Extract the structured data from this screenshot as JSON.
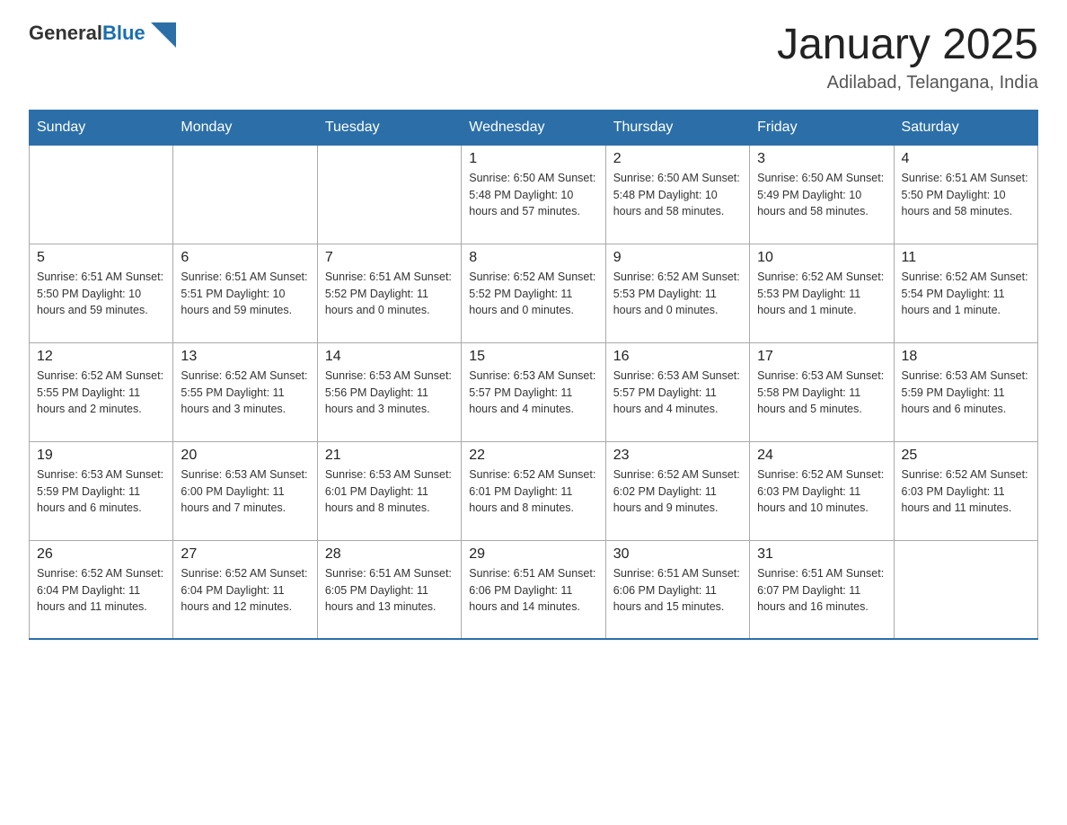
{
  "header": {
    "logo_text_general": "General",
    "logo_text_blue": "Blue",
    "title": "January 2025",
    "subtitle": "Adilabad, Telangana, India"
  },
  "weekdays": [
    "Sunday",
    "Monday",
    "Tuesday",
    "Wednesday",
    "Thursday",
    "Friday",
    "Saturday"
  ],
  "weeks": [
    [
      {
        "day": "",
        "info": ""
      },
      {
        "day": "",
        "info": ""
      },
      {
        "day": "",
        "info": ""
      },
      {
        "day": "1",
        "info": "Sunrise: 6:50 AM\nSunset: 5:48 PM\nDaylight: 10 hours\nand 57 minutes."
      },
      {
        "day": "2",
        "info": "Sunrise: 6:50 AM\nSunset: 5:48 PM\nDaylight: 10 hours\nand 58 minutes."
      },
      {
        "day": "3",
        "info": "Sunrise: 6:50 AM\nSunset: 5:49 PM\nDaylight: 10 hours\nand 58 minutes."
      },
      {
        "day": "4",
        "info": "Sunrise: 6:51 AM\nSunset: 5:50 PM\nDaylight: 10 hours\nand 58 minutes."
      }
    ],
    [
      {
        "day": "5",
        "info": "Sunrise: 6:51 AM\nSunset: 5:50 PM\nDaylight: 10 hours\nand 59 minutes."
      },
      {
        "day": "6",
        "info": "Sunrise: 6:51 AM\nSunset: 5:51 PM\nDaylight: 10 hours\nand 59 minutes."
      },
      {
        "day": "7",
        "info": "Sunrise: 6:51 AM\nSunset: 5:52 PM\nDaylight: 11 hours\nand 0 minutes."
      },
      {
        "day": "8",
        "info": "Sunrise: 6:52 AM\nSunset: 5:52 PM\nDaylight: 11 hours\nand 0 minutes."
      },
      {
        "day": "9",
        "info": "Sunrise: 6:52 AM\nSunset: 5:53 PM\nDaylight: 11 hours\nand 0 minutes."
      },
      {
        "day": "10",
        "info": "Sunrise: 6:52 AM\nSunset: 5:53 PM\nDaylight: 11 hours\nand 1 minute."
      },
      {
        "day": "11",
        "info": "Sunrise: 6:52 AM\nSunset: 5:54 PM\nDaylight: 11 hours\nand 1 minute."
      }
    ],
    [
      {
        "day": "12",
        "info": "Sunrise: 6:52 AM\nSunset: 5:55 PM\nDaylight: 11 hours\nand 2 minutes."
      },
      {
        "day": "13",
        "info": "Sunrise: 6:52 AM\nSunset: 5:55 PM\nDaylight: 11 hours\nand 3 minutes."
      },
      {
        "day": "14",
        "info": "Sunrise: 6:53 AM\nSunset: 5:56 PM\nDaylight: 11 hours\nand 3 minutes."
      },
      {
        "day": "15",
        "info": "Sunrise: 6:53 AM\nSunset: 5:57 PM\nDaylight: 11 hours\nand 4 minutes."
      },
      {
        "day": "16",
        "info": "Sunrise: 6:53 AM\nSunset: 5:57 PM\nDaylight: 11 hours\nand 4 minutes."
      },
      {
        "day": "17",
        "info": "Sunrise: 6:53 AM\nSunset: 5:58 PM\nDaylight: 11 hours\nand 5 minutes."
      },
      {
        "day": "18",
        "info": "Sunrise: 6:53 AM\nSunset: 5:59 PM\nDaylight: 11 hours\nand 6 minutes."
      }
    ],
    [
      {
        "day": "19",
        "info": "Sunrise: 6:53 AM\nSunset: 5:59 PM\nDaylight: 11 hours\nand 6 minutes."
      },
      {
        "day": "20",
        "info": "Sunrise: 6:53 AM\nSunset: 6:00 PM\nDaylight: 11 hours\nand 7 minutes."
      },
      {
        "day": "21",
        "info": "Sunrise: 6:53 AM\nSunset: 6:01 PM\nDaylight: 11 hours\nand 8 minutes."
      },
      {
        "day": "22",
        "info": "Sunrise: 6:52 AM\nSunset: 6:01 PM\nDaylight: 11 hours\nand 8 minutes."
      },
      {
        "day": "23",
        "info": "Sunrise: 6:52 AM\nSunset: 6:02 PM\nDaylight: 11 hours\nand 9 minutes."
      },
      {
        "day": "24",
        "info": "Sunrise: 6:52 AM\nSunset: 6:03 PM\nDaylight: 11 hours\nand 10 minutes."
      },
      {
        "day": "25",
        "info": "Sunrise: 6:52 AM\nSunset: 6:03 PM\nDaylight: 11 hours\nand 11 minutes."
      }
    ],
    [
      {
        "day": "26",
        "info": "Sunrise: 6:52 AM\nSunset: 6:04 PM\nDaylight: 11 hours\nand 11 minutes."
      },
      {
        "day": "27",
        "info": "Sunrise: 6:52 AM\nSunset: 6:04 PM\nDaylight: 11 hours\nand 12 minutes."
      },
      {
        "day": "28",
        "info": "Sunrise: 6:51 AM\nSunset: 6:05 PM\nDaylight: 11 hours\nand 13 minutes."
      },
      {
        "day": "29",
        "info": "Sunrise: 6:51 AM\nSunset: 6:06 PM\nDaylight: 11 hours\nand 14 minutes."
      },
      {
        "day": "30",
        "info": "Sunrise: 6:51 AM\nSunset: 6:06 PM\nDaylight: 11 hours\nand 15 minutes."
      },
      {
        "day": "31",
        "info": "Sunrise: 6:51 AM\nSunset: 6:07 PM\nDaylight: 11 hours\nand 16 minutes."
      },
      {
        "day": "",
        "info": ""
      }
    ]
  ]
}
